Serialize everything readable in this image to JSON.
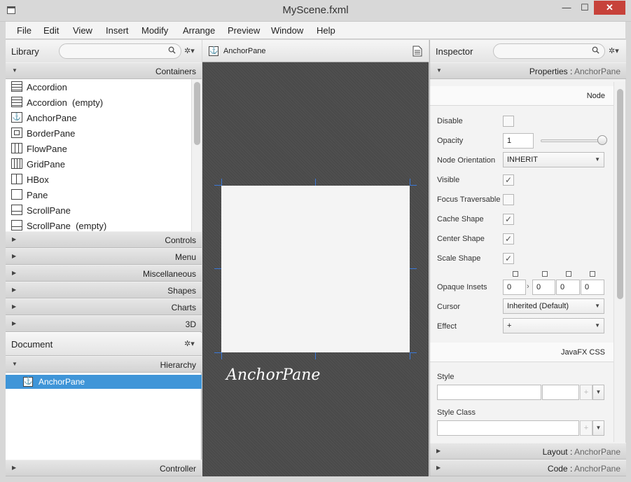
{
  "window": {
    "title": "MyScene.fxml",
    "min": "—",
    "max": "☐",
    "close": "✕"
  },
  "menu": [
    "File",
    "Edit",
    "View",
    "Insert",
    "Modify",
    "Arrange",
    "Preview",
    "Window",
    "Help"
  ],
  "library": {
    "title": "Library",
    "search_placeholder": "",
    "gear": "✲▾",
    "section_open": "Containers",
    "items": [
      "Accordion",
      "Accordion  (empty)",
      "AnchorPane",
      "BorderPane",
      "FlowPane",
      "GridPane",
      "HBox",
      "Pane",
      "ScrollPane",
      "ScrollPane  (empty)"
    ],
    "sections": [
      "Controls",
      "Menu",
      "Miscellaneous",
      "Shapes",
      "Charts",
      "3D"
    ]
  },
  "document": {
    "title": "Document",
    "gear": "✲▾",
    "hierarchy_label": "Hierarchy",
    "hierarchy_item": "AnchorPane",
    "controller_label": "Controller"
  },
  "center": {
    "breadcrumb": "AnchorPane",
    "canvas_label": "AnchorPane"
  },
  "inspector": {
    "title": "Inspector",
    "gear": "✲▾",
    "properties_prefix": "Properties : ",
    "properties_target": "AnchorPane",
    "node_section": "Node",
    "css_section": "JavaFX CSS",
    "props": {
      "disable": "Disable",
      "opacity": "Opacity",
      "opacity_value": "1",
      "opacity_slider": 1,
      "orientation": "Node Orientation",
      "orientation_value": "INHERIT",
      "visible": "Visible",
      "focus": "Focus Traversable",
      "cache_shape": "Cache Shape",
      "center_shape": "Center Shape",
      "scale_shape": "Scale Shape",
      "opaque_insets": "Opaque Insets",
      "insets": [
        "0",
        "0",
        "0",
        "0"
      ],
      "cursor": "Cursor",
      "cursor_value": "Inherited (Default)",
      "effect": "Effect",
      "effect_value": "+",
      "style": "Style",
      "style_class": "Style Class"
    },
    "checks": {
      "disable": false,
      "visible": true,
      "focus": false,
      "cache_shape": true,
      "center_shape": true,
      "scale_shape": true
    },
    "layout_prefix": "Layout : ",
    "layout_target": "AnchorPane",
    "code_prefix": "Code : ",
    "code_target": "AnchorPane",
    "plus": "+"
  },
  "colors": {
    "selection": "#3f95d8",
    "canvas": "#4a4a4a",
    "close": "#c7423a"
  }
}
